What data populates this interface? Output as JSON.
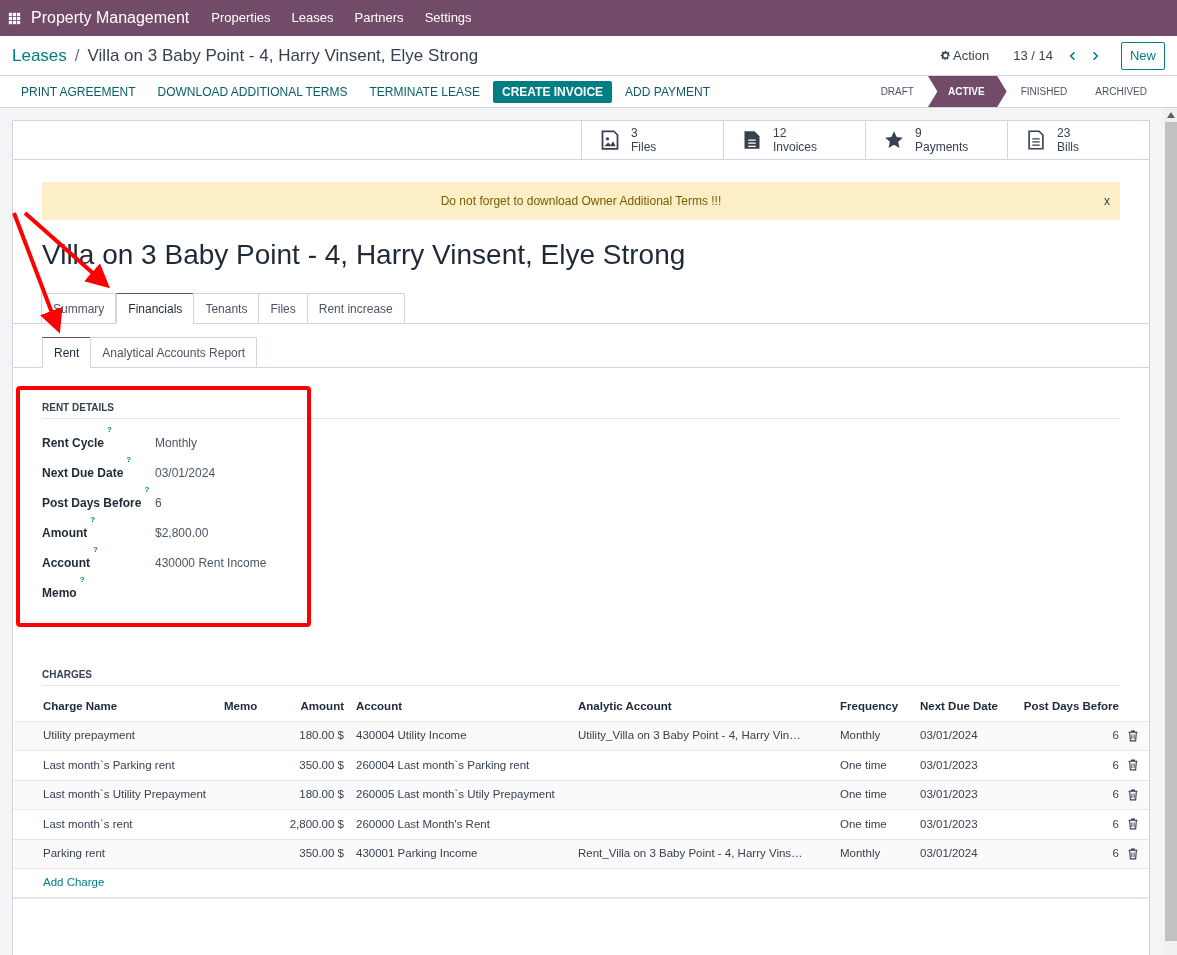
{
  "navbar": {
    "app_name": "Property Management",
    "menu": [
      "Properties",
      "Leases",
      "Partners",
      "Settings"
    ]
  },
  "breadcrumb": {
    "parent": "Leases",
    "separator": "/",
    "current": "Villa on 3 Baby Point - 4, Harry Vinsent, Elye Strong"
  },
  "control_panel": {
    "action": "Action",
    "pager": "13 / 14",
    "new_button": "New"
  },
  "action_buttons": [
    {
      "label": "PRINT AGREEMENT",
      "primary": false
    },
    {
      "label": "DOWNLOAD ADDITIONAL TERMS",
      "primary": false
    },
    {
      "label": "TERMINATE LEASE",
      "primary": false
    },
    {
      "label": "CREATE INVOICE",
      "primary": true
    },
    {
      "label": "ADD PAYMENT",
      "primary": false
    }
  ],
  "stages": [
    {
      "label": "DRAFT",
      "selected": false
    },
    {
      "label": "ACTIVE",
      "selected": true
    },
    {
      "label": "FINISHED",
      "selected": false
    },
    {
      "label": "ARCHIVED",
      "selected": false
    }
  ],
  "smart_buttons": [
    {
      "kind": "image",
      "count": "3",
      "label": "Files"
    },
    {
      "kind": "document",
      "count": "12",
      "label": "Invoices"
    },
    {
      "kind": "star",
      "count": "9",
      "label": "Payments"
    },
    {
      "kind": "lines",
      "count": "23",
      "label": "Bills"
    }
  ],
  "alert": {
    "message": "Do not forget to download Owner Additional Terms !!!",
    "close": "x"
  },
  "title": "Villa on 3 Baby Point - 4, Harry Vinsent, Elye Strong",
  "tabs": [
    {
      "label": "Summary",
      "selected": false
    },
    {
      "label": "Financials",
      "selected": true
    },
    {
      "label": "Tenants",
      "selected": false
    },
    {
      "label": "Files",
      "selected": false
    },
    {
      "label": "Rent increase",
      "selected": false
    }
  ],
  "sub_tabs": [
    {
      "label": "Rent",
      "selected": true
    },
    {
      "label": "Analytical Accounts Report",
      "selected": false
    }
  ],
  "rent_details": {
    "heading": "RENT DETAILS",
    "fields": [
      {
        "label": "Rent Cycle",
        "help": "?",
        "value": "Monthly"
      },
      {
        "label": "Next Due Date",
        "help": "?",
        "value": "03/01/2024"
      },
      {
        "label": "Post Days Before",
        "help": "?",
        "value": "6"
      },
      {
        "label": "Amount",
        "help": "?",
        "value": "$2,800.00"
      },
      {
        "label": "Account",
        "help": "?",
        "value": "430000 Rent Income"
      },
      {
        "label": "Memo",
        "help": "?"
      }
    ]
  },
  "charges": {
    "heading": "CHARGES",
    "columns": [
      "Charge Name",
      "Memo",
      "Amount",
      "Account",
      "Analytic Account",
      "Frequency",
      "Next Due Date",
      "Post Days Before"
    ],
    "rows": [
      [
        "Utility prepayment",
        "",
        "180.00 $",
        "430004 Utility Income",
        "Utility_Villa on 3 Baby Point - 4, Harry Vin…",
        "Monthly",
        "03/01/2024",
        "6"
      ],
      [
        "Last month`s Parking rent",
        "",
        "350.00 $",
        "260004 Last month`s Parking rent",
        "",
        "One time",
        "03/01/2023",
        "6"
      ],
      [
        "Last month`s Utility Prepayment",
        "",
        "180.00 $",
        "260005 Last month`s Utily Prepayment",
        "",
        "One time",
        "03/01/2023",
        "6"
      ],
      [
        "Last month`s rent",
        "",
        "2,800.00 $",
        "260000 Last Month's Rent",
        "",
        "One time",
        "03/01/2023",
        "6"
      ],
      [
        "Parking rent",
        "",
        "350.00 $",
        "430001 Parking Income",
        "Rent_Villa on 3 Baby Point - 4, Harry Vins…",
        "Monthly",
        "03/01/2024",
        "6"
      ]
    ],
    "add_link": "Add Charge"
  }
}
